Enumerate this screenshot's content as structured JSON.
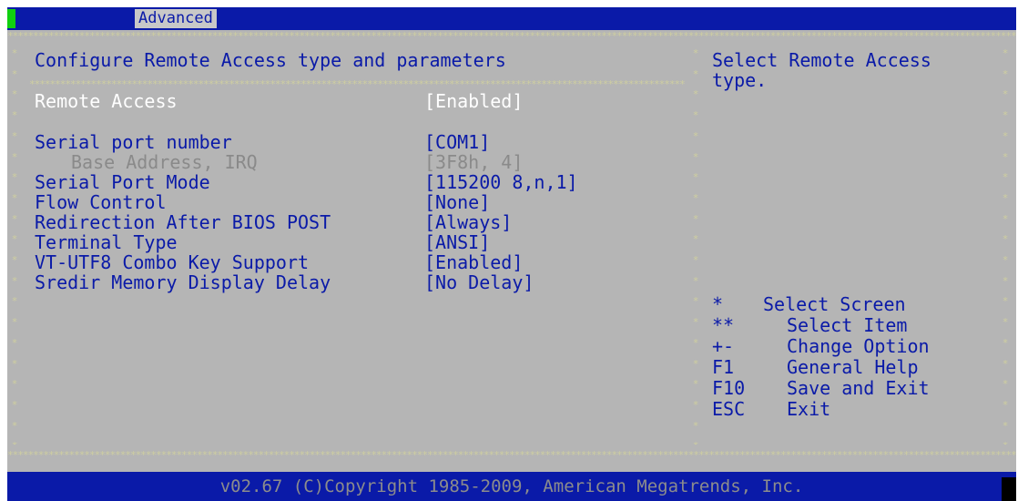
{
  "tab": "Advanced",
  "section_title": "Configure Remote Access type and parameters",
  "settings": [
    {
      "label": "Remote Access",
      "value": "[Enabled]"
    },
    {
      "label": "Serial port number",
      "value": "[COM1]"
    },
    {
      "label": "Base Address, IRQ",
      "value": "[3F8h, 4]"
    },
    {
      "label": "Serial Port Mode",
      "value": "[115200 8,n,1]"
    },
    {
      "label": "Flow Control",
      "value": "[None]"
    },
    {
      "label": "Redirection After BIOS POST",
      "value": "[Always]"
    },
    {
      "label": "Terminal Type",
      "value": "[ANSI]"
    },
    {
      "label": "VT-UTF8 Combo Key Support",
      "value": "[Enabled]"
    },
    {
      "label": "Sredir Memory Display Delay",
      "value": "[No Delay]"
    }
  ],
  "help": {
    "line1": "Select Remote Access",
    "line2": "type."
  },
  "keys": [
    {
      "key": "*",
      "desc": "Select Screen"
    },
    {
      "key": "**",
      "desc": "Select Item"
    },
    {
      "key": "+-",
      "desc": "Change Option"
    },
    {
      "key": "F1",
      "desc": "General Help"
    },
    {
      "key": "F10",
      "desc": "Save and Exit"
    },
    {
      "key": "ESC",
      "desc": "Exit"
    }
  ],
  "footer": "v02.67 (C)Copyright 1985-2009, American Megatrends, Inc.",
  "colors": {
    "title_bar": "#0a1aa8",
    "body_bg": "#b5b5b5",
    "text": "#0a1aa8",
    "selected_text": "#ffffff",
    "disabled_text": "#8a8a8a",
    "border_stars": "#cfcfa0",
    "cursor_block": "#10d010"
  }
}
